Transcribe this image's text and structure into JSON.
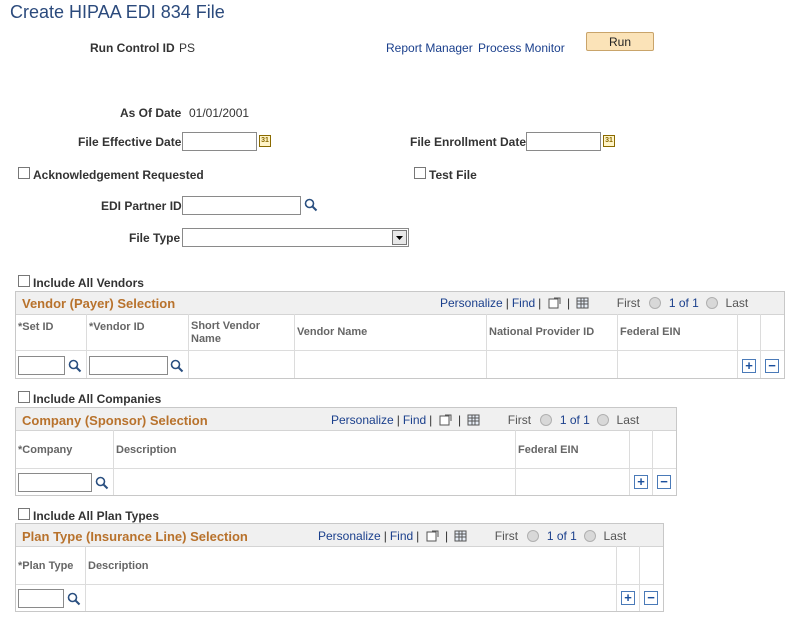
{
  "page": {
    "title": "Create HIPAA EDI 834 File"
  },
  "header": {
    "run_control_label": "Run Control ID",
    "run_control_value": "PS",
    "report_manager_link": "Report Manager",
    "process_monitor_link": "Process Monitor",
    "run_button": "Run"
  },
  "form": {
    "as_of_date_label": "As Of Date",
    "as_of_date_value": "01/01/2001",
    "file_effective_date_label": "File Effective Date",
    "file_effective_date_value": "",
    "file_enrollment_date_label": "File Enrollment Date",
    "file_enrollment_date_value": "",
    "ack_requested_label": "Acknowledgement Requested",
    "test_file_label": "Test File",
    "edi_partner_label": "EDI Partner ID",
    "edi_partner_value": "",
    "file_type_label": "File Type",
    "file_type_value": ""
  },
  "vendors": {
    "include_all_label": "Include All Vendors",
    "grid_title": "Vendor (Payer) Selection",
    "personalize": "Personalize",
    "find": "Find",
    "first": "First",
    "page_count": "1 of 1",
    "last": "Last",
    "columns": [
      "*Set ID",
      "*Vendor ID",
      "Short Vendor Name",
      "Vendor Name",
      "National Provider ID",
      "Federal EIN"
    ],
    "row": {
      "set_id": "",
      "vendor_id": ""
    }
  },
  "companies": {
    "include_all_label": "Include All Companies",
    "grid_title": "Company (Sponsor) Selection",
    "personalize": "Personalize",
    "find": "Find",
    "first": "First",
    "page_count": "1 of 1",
    "last": "Last",
    "columns": [
      "*Company",
      "Description",
      "Federal EIN"
    ],
    "row": {
      "company": ""
    }
  },
  "plans": {
    "include_all_label": "Include All Plan Types",
    "grid_title": "Plan Type (Insurance Line) Selection",
    "personalize": "Personalize",
    "find": "Find",
    "first": "First",
    "page_count": "1 of 1",
    "last": "Last",
    "columns": [
      "*Plan Type",
      "Description"
    ],
    "row": {
      "plan_type": ""
    }
  },
  "icons": {
    "calendar": "calendar-icon",
    "lookup": "magnifier-icon",
    "add": "+",
    "remove": "−",
    "pipe": "|",
    "calendar_glyph": "31"
  },
  "colors": {
    "title": "#2b4a7c",
    "grid_title": "#b8722c",
    "link": "#1a3f8c",
    "run_button": "#fbe3b8"
  }
}
